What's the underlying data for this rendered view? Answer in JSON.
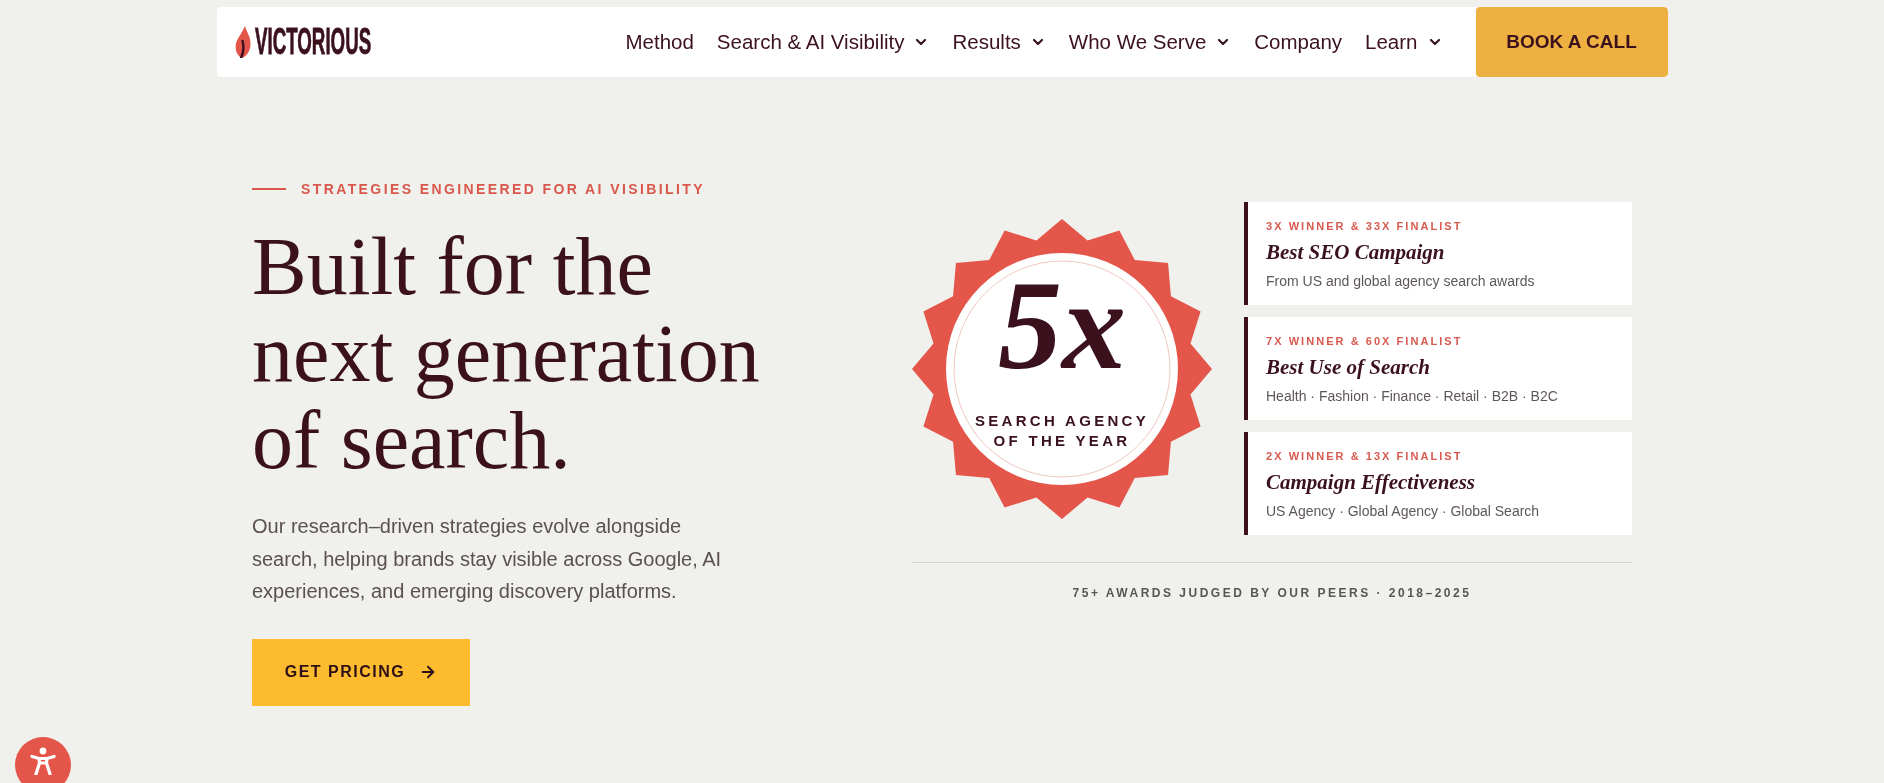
{
  "header": {
    "logo": {
      "text": "VICTORIOUS"
    },
    "nav": [
      {
        "label": "Method",
        "has_menu": false
      },
      {
        "label": "Search & AI Visibility",
        "has_menu": true
      },
      {
        "label": "Results",
        "has_menu": true
      },
      {
        "label": "Who We Serve",
        "has_menu": true
      },
      {
        "label": "Company",
        "has_menu": false
      },
      {
        "label": "Learn",
        "has_menu": true
      }
    ],
    "cta": "BOOK A CALL"
  },
  "hero": {
    "eyebrow": "STRATEGIES ENGINEERED FOR AI VISIBILITY",
    "headline": "Built for the next generation of search.",
    "body": "Our research–driven strategies evolve alongside search, helping brands stay visible across Google, AI experiences, and emerging discovery platforms.",
    "button": "GET PRICING"
  },
  "awards": {
    "seal": {
      "count": "5x",
      "title": "SEARCH AGENCY OF THE YEAR"
    },
    "cards": [
      {
        "tally": "3X WINNER & 33X FINALIST",
        "title": "Best SEO Campaign",
        "detail": "From US and global agency search awards"
      },
      {
        "tally": "7X WINNER & 60X FINALIST",
        "title": "Best Use of Search",
        "detail": "Health · Fashion · Finance · Retail · B2B · B2C"
      },
      {
        "tally": "2X WINNER & 13X FINALIST",
        "title": "Campaign Effectiveness",
        "detail": "US Agency · Global Agency · Global Search"
      }
    ],
    "footer": "75+ AWARDS JUDGED BY OUR PEERS · 2018–2025"
  }
}
